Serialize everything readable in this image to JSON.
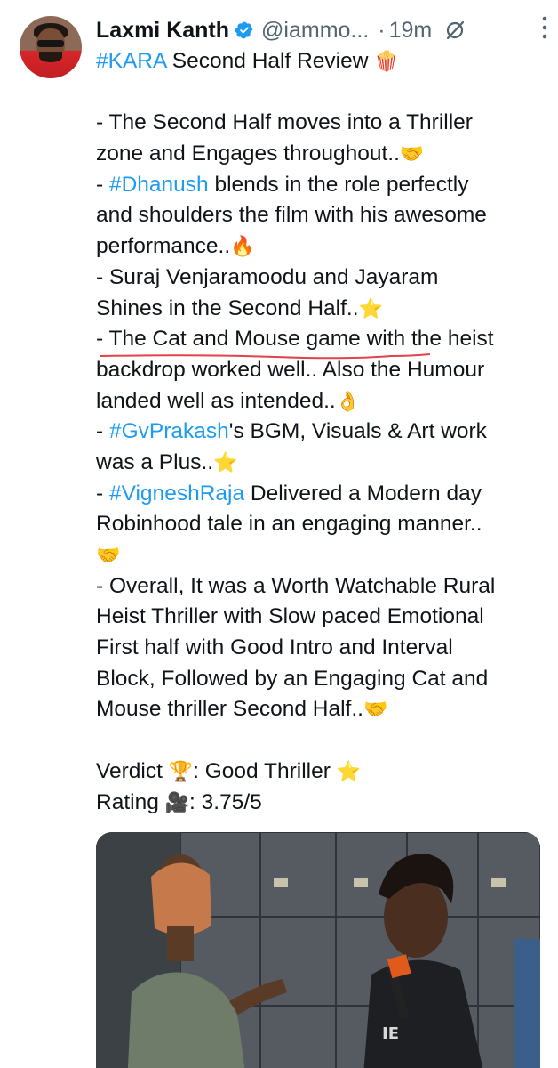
{
  "author": {
    "name": "Laxmi Kanth",
    "handle": "@iammo...",
    "separator": "·",
    "time": "19m"
  },
  "tweet": {
    "lines": [
      [
        {
          "t": "#KARA",
          "tag": true
        },
        {
          "t": " Second Half Review "
        },
        {
          "t": "🍿",
          "emoji": true
        }
      ],
      [],
      [
        {
          "t": "- The Second Half moves into a Thriller"
        }
      ],
      [
        {
          "t": "zone and Engages throughout.."
        },
        {
          "t": "🤝",
          "emoji": true
        }
      ],
      [
        {
          "t": "- "
        },
        {
          "t": "#Dhanush",
          "tag": true
        },
        {
          "t": " blends in the role perfectly"
        }
      ],
      [
        {
          "t": "and shoulders the film with his awesome"
        }
      ],
      [
        {
          "t": "performance.."
        },
        {
          "t": "🔥",
          "emoji": true
        }
      ],
      [
        {
          "t": "- Suraj Venjaramoodu and Jayaram"
        }
      ],
      [
        {
          "t": "Shines in the Second Half.."
        },
        {
          "t": "⭐",
          "emoji": true
        }
      ],
      [
        {
          "t": "- The Cat and Mouse game with the heist",
          "underline": true
        }
      ],
      [
        {
          "t": "backdrop worked well.. Also the Humour"
        }
      ],
      [
        {
          "t": "landed well as intended.."
        },
        {
          "t": "👌",
          "emoji": true
        }
      ],
      [
        {
          "t": "- "
        },
        {
          "t": "#GvPrakash",
          "tag": true
        },
        {
          "t": "'s BGM, Visuals & Art work"
        }
      ],
      [
        {
          "t": "was a Plus.."
        },
        {
          "t": "⭐",
          "emoji": true
        }
      ],
      [
        {
          "t": "- "
        },
        {
          "t": "#VigneshRaja",
          "tag": true
        },
        {
          "t": " Delivered a Modern day"
        }
      ],
      [
        {
          "t": "Robinhood tale in an engaging manner.."
        }
      ],
      [
        {
          "t": "🤝",
          "emoji": true
        }
      ],
      [
        {
          "t": "- Overall, It was a Worth Watchable Rural"
        }
      ],
      [
        {
          "t": "Heist Thriller with Slow paced Emotional"
        }
      ],
      [
        {
          "t": "First half with Good Intro and Interval"
        }
      ],
      [
        {
          "t": "Block, Followed by an Engaging Cat and"
        }
      ],
      [
        {
          "t": "Mouse thriller Second Half.."
        },
        {
          "t": "🤝",
          "emoji": true
        }
      ],
      [],
      [
        {
          "t": "Verdict "
        },
        {
          "t": "🏆",
          "emoji": true
        },
        {
          "t": ": Good Thriller "
        },
        {
          "t": "⭐",
          "emoji": true
        }
      ],
      [
        {
          "t": "Rating "
        },
        {
          "t": "🎥",
          "emoji": true
        },
        {
          "t": ": 3.75/5"
        }
      ]
    ]
  },
  "colors": {
    "hashtag": "#1d9bf0",
    "verified": "#1d9bf0",
    "muted": "#536471",
    "underline": "#e0434b"
  },
  "icons": {
    "verified": "verified-badge-icon",
    "premium": "grok-slash-icon",
    "more": "more-vertical-icon"
  }
}
